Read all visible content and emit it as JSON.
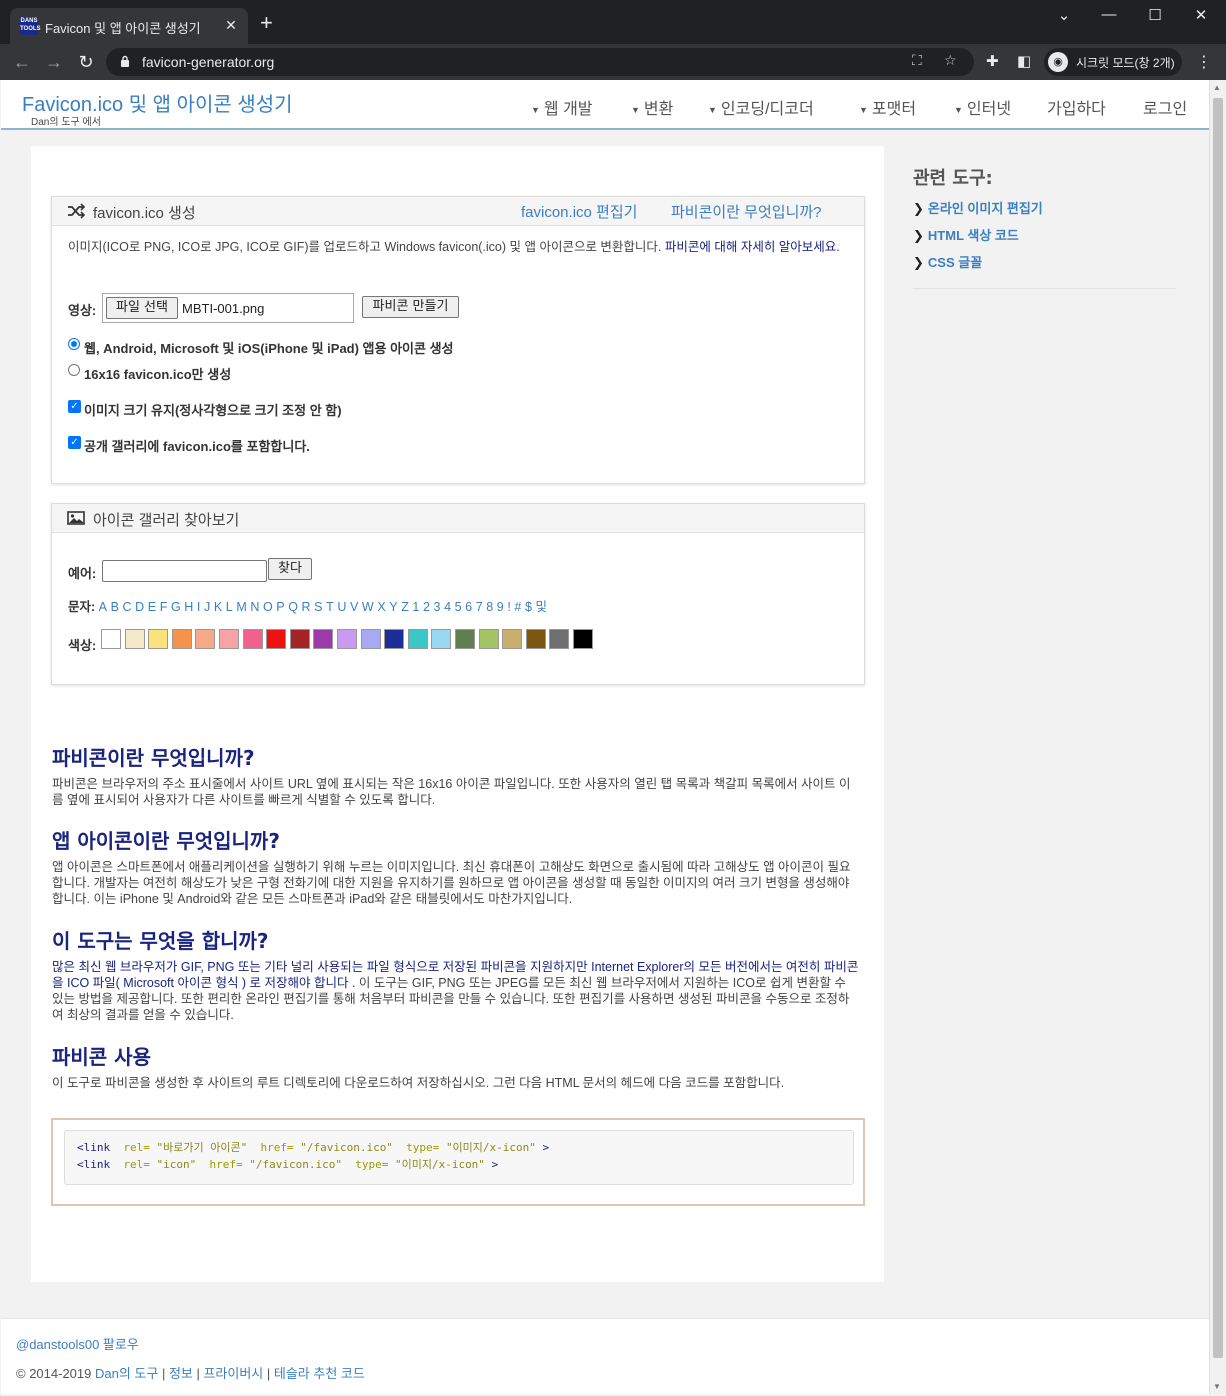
{
  "browser": {
    "tab_title": "Favicon 및 앱 아이콘 생성기",
    "tab_favicon_text": "DANS TOOLS",
    "url": "favicon-generator.org",
    "profile_label": "시크릿 모드(창 2개)"
  },
  "header": {
    "brand": "Favicon.ico 및 앱 아이콘 생성기",
    "brand_sub": "Dan의 도구 에서",
    "nav": [
      "웹 개발",
      "변환",
      "인코딩/디코더",
      "포맷터",
      "인터넷"
    ],
    "signup": "가입하다",
    "login": "로그인"
  },
  "generate": {
    "title": "favicon.ico 생성",
    "link_editor": "favicon.ico 편집기",
    "link_what": "파비콘이란 무엇입니까?",
    "desc": "이미지(ICO로 PNG, ICO로 JPG, ICO로 GIF)를 업로드하고 Windows favicon(.ico) 및 앱 아이콘으로 변환합니다. ",
    "desc_link": "파비콘에 대해 자세히 알아보세요.",
    "image_label": "영상:",
    "file_button": "파일 선택",
    "file_name": "MBTI-001.png",
    "make_button": "파비콘 만들기",
    "option_all": "웹, Android, Microsoft 및 iOS(iPhone 및 iPad) 앱용 아이콘 생성",
    "option_16": "16x16 favicon.ico만 생성",
    "keep_size_a": "이미지 크기 유지",
    "keep_size_b": "(정사각형으로 크기 조정 안 함)",
    "gallery_a": "공개 갤러리에 ",
    "gallery_b": "favicon.ico",
    "gallery_c": "를 포함합니다."
  },
  "gallery": {
    "title": "아이콘 갤러리 찾아보기",
    "example_label": "예어:",
    "search_value": "",
    "find_button": "찾다",
    "letters_label": "문자:",
    "letters": [
      "A",
      "B",
      "C",
      "D",
      "E",
      "F",
      "G",
      "H",
      "I",
      "J",
      "K",
      "L",
      "M",
      "N",
      "O",
      "P",
      "Q",
      "R",
      "S",
      "T",
      "U",
      "V",
      "W",
      "X",
      "Y",
      "Z",
      "1",
      "2",
      "3",
      "4",
      "5",
      "6",
      "7",
      "8",
      "9",
      "!",
      "#",
      "$",
      "및"
    ],
    "colors_label": "색상:",
    "colors": [
      "#ffffff",
      "#f3e8c8",
      "#fbe27a",
      "#f7924a",
      "#f6a986",
      "#f7a3a6",
      "#f2608e",
      "#ef1212",
      "#a32525",
      "#9c3aa9",
      "#c89af0",
      "#a7a9f5",
      "#1d2f96",
      "#39c7c8",
      "#97d7f1",
      "#5f7f4f",
      "#a3c463",
      "#c9ae6c",
      "#7c5611",
      "#6f6f6f",
      "#000000"
    ]
  },
  "content": {
    "h_what": "파비콘이란 무엇입니까?",
    "p_what": "파비콘은 브라우저의 주소 표시줄에서 사이트 URL 옆에 표시되는 작은 16x16 아이콘 파일입니다. 또한 사용자의 열린 탭 목록과 책갈피 목록에서 사이트 이름 옆에 표시되어 사용자가 다른 사이트를 빠르게 식별할 수 있도록 합니다.",
    "h_app": "앱 아이콘이란 무엇입니까?",
    "p_app": "앱 아이콘은 스마트폰에서 애플리케이션을 실행하기 위해 누르는 이미지입니다. 최신 휴대폰이 고해상도 화면으로 출시됨에 따라 고해상도 앱 아이콘이 필요합니다. 개발자는 여전히 해상도가 낮은 구형 전화기에 대한 지원을 유지하기를 원하므로 앱 아이콘을 생성할 때 동일한 이미지의 여러 크기 변형을 생성해야 합니다. 이는 iPhone 및 Android와 같은 모든 스마트폰과 iPad와 같은 태블릿에서도 마찬가지입니다.",
    "h_tool": "이 도구는 무엇을 합니까?",
    "p_tool_link": "많은 최신 웹 브라우저가 GIF, PNG 또는 기타 널리 사용되는 파일 형식으로 저장된 파비콘을 지원하지만 Internet Explorer의 모든 버전에서는 여전히 파비콘을 ICO 파일( Microsoft 아이콘 형식 ) 로 저장해야 합니다 .",
    "p_tool_rest": " 이 도구는 GIF, PNG 또는 JPEG를 모든 최신 웹 브라우저에서 지원하는 ICO로 쉽게 변환할 수 있는 방법을 제공합니다. 또한 편리한 온라인 편집기를 통해 처음부터 파비콘을 만들 수 있습니다. 또한 편집기를 사용하면 생성된 파비콘을 수동으로 조정하여 최상의 결과를 얻을 수 있습니다.",
    "h_use": "파비콘 사용",
    "p_use": "이 도구로 파비콘을 생성한 후 사이트의 루트 디렉토리에 다운로드하여 저장하십시오. 그런 다음 HTML 문서의 헤드에 다음 코드를 포함합니다.",
    "code": [
      {
        "tag": "<link",
        "a1": "rel=",
        "v1": "\"바로가기 아이콘\"",
        "a2": "href=",
        "v2": "\"/favicon.ico\"",
        "a3": "type=",
        "v3": "\"이미지/x-icon\"",
        "end": ">"
      },
      {
        "tag": "<link",
        "a1": "rel=",
        "v1": "\"icon\"",
        "a2": "href=",
        "v2": "\"/favicon.ico\"",
        "a3": "type=",
        "v3": "\"이미지/x-icon\"",
        "end": ">"
      }
    ]
  },
  "sidebar": {
    "title": "관련 도구:",
    "items": [
      "온라인 이미지 편집기",
      "HTML 색상 코드",
      "CSS 글꼴"
    ]
  },
  "footer": {
    "follow": "@danstools00 팔로우",
    "copyright": "© 2014-2019 ",
    "dans_tools": "Dan의 도구",
    "sep": " | ",
    "about": "정보",
    "privacy": "프라이버시",
    "tesla": "테슬라 추천 코드"
  }
}
